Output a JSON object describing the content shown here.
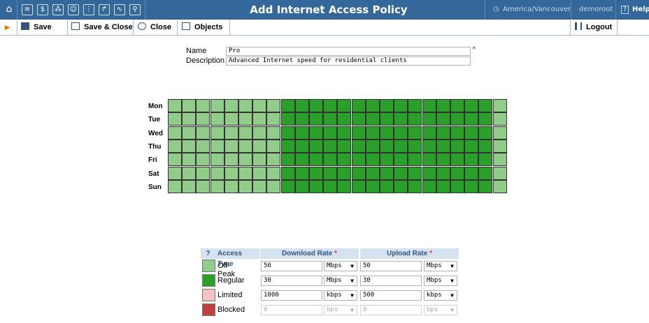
{
  "window": {
    "title": "Add Internet Access Policy",
    "timezone": "America/Vancouver",
    "user": "demoroot",
    "help": "Help"
  },
  "toolbar": {
    "save": "Save",
    "save_close": "Save & Close",
    "close": "Close",
    "objects": "Objects",
    "logout": "Logout"
  },
  "form": {
    "name_label": "Name",
    "name_value": "Pro",
    "description_label": "Description",
    "description_value": "Advanced Internet speed for residential clients"
  },
  "schedule": {
    "days": [
      "Mon",
      "Tue",
      "Wed",
      "Thu",
      "Fri",
      "Sat",
      "Sun"
    ],
    "hour_types": [
      "off-peak",
      "off-peak",
      "off-peak",
      "off-peak",
      "off-peak",
      "off-peak",
      "off-peak",
      "off-peak",
      "regular",
      "regular",
      "regular",
      "regular",
      "regular",
      "regular",
      "regular",
      "regular",
      "regular",
      "regular",
      "regular",
      "regular",
      "regular",
      "regular",
      "regular",
      "off-peak"
    ],
    "colors": {
      "off-peak": "#92cc8a",
      "regular": "#2aa02a"
    }
  },
  "access_table": {
    "headers": {
      "help": "?",
      "type": "Access Type",
      "download": "Download Rate",
      "upload": "Upload Rate"
    },
    "rows": [
      {
        "type": "Off-Peak",
        "color": "#92cc8a",
        "download": "50",
        "download_unit": "Mbps",
        "upload": "50",
        "upload_unit": "Mbps",
        "disabled": false
      },
      {
        "type": "Regular",
        "color": "#2aa02a",
        "download": "30",
        "download_unit": "Mbps",
        "upload": "30",
        "upload_unit": "Mbps",
        "disabled": false
      },
      {
        "type": "Limited",
        "color": "#f4c2c2",
        "download": "1000",
        "download_unit": "kbps",
        "upload": "500",
        "upload_unit": "kbps",
        "disabled": false
      },
      {
        "type": "Blocked",
        "color": "#c04040",
        "download": "0",
        "download_unit": "bps",
        "upload": "0",
        "upload_unit": "bps",
        "disabled": true
      }
    ]
  }
}
